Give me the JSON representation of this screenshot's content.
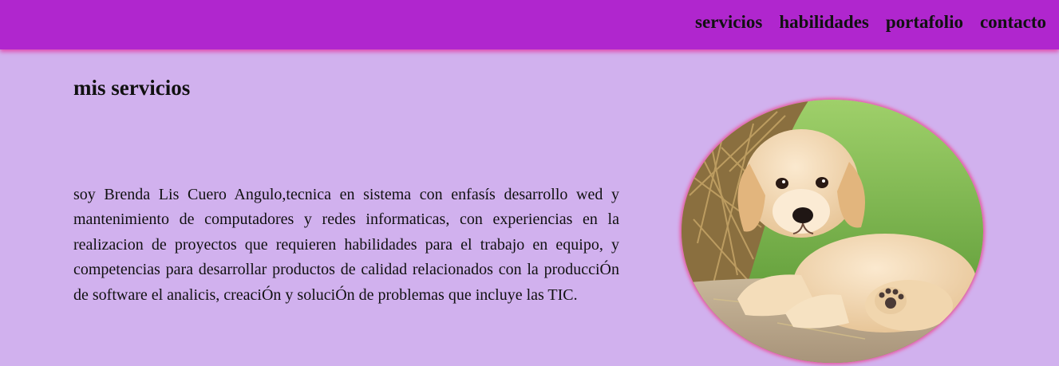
{
  "nav": {
    "items": [
      {
        "label": "servicios"
      },
      {
        "label": "habilidades"
      },
      {
        "label": "portafolio"
      },
      {
        "label": "contacto"
      }
    ]
  },
  "section": {
    "title": "mis servicios",
    "description": "soy Brenda Lis Cuero Angulo,tecnica en sistema con enfasís desarrollo wed y mantenimiento de computadores y redes informaticas, con experiencias en la realizacion de proyectos que requieren habilidades para el trabajo en equipo, y competencias para desarrollar productos de calidad relacionados con la producciÓn de software el analicis, creaciÓn y soluciÓn de problemas que incluye las TIC."
  },
  "colors": {
    "header_bg": "#b026ce",
    "page_bg": "#d1b1ee",
    "image_border": "#e8559f"
  }
}
